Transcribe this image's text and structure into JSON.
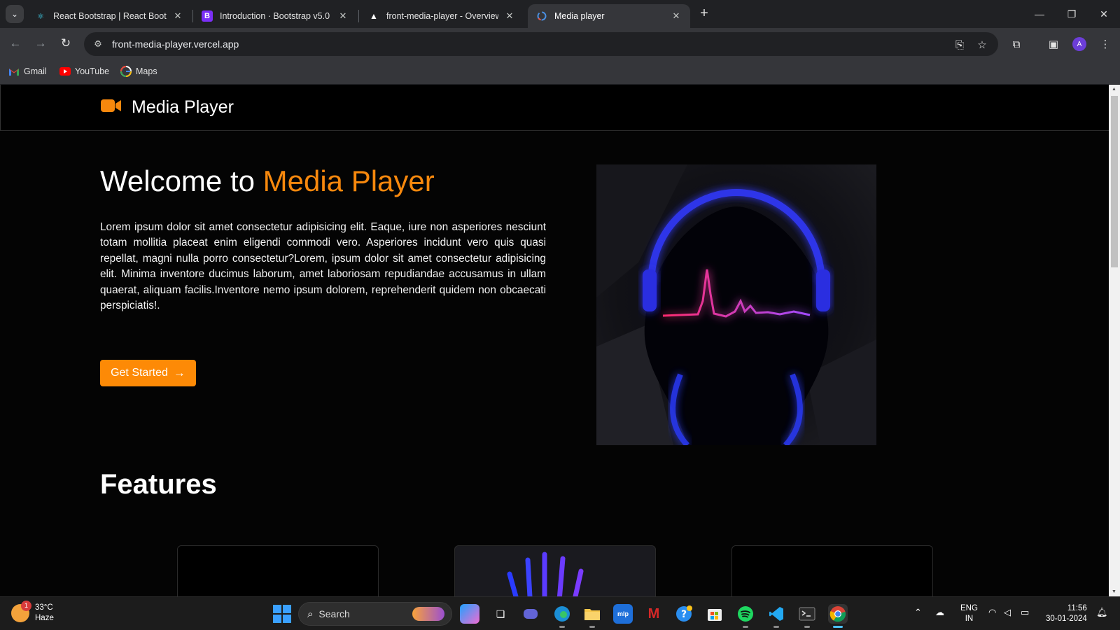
{
  "browser": {
    "tabs": [
      {
        "title": "React Bootstrap | React Bootstrap",
        "favicon": "react-bootstrap-icon"
      },
      {
        "title": "Introduction · Bootstrap v5.0",
        "favicon": "bootstrap-icon"
      },
      {
        "title": "front-media-player - Overview",
        "favicon": "vercel-icon"
      },
      {
        "title": "Media player",
        "favicon": "chrome-loading-icon",
        "active": true
      }
    ],
    "url": "front-media-player.vercel.app",
    "profile_initial": "A",
    "bookmarks": [
      {
        "label": "Gmail",
        "icon": "gmail-icon"
      },
      {
        "label": "YouTube",
        "icon": "youtube-icon"
      },
      {
        "label": "Maps",
        "icon": "google-icon"
      }
    ]
  },
  "page": {
    "brand": "Media Player",
    "hero_title_prefix": "Welcome to ",
    "hero_title_accent": "Media Player",
    "hero_text": "Lorem ipsum dolor sit amet consectetur adipisicing elit. Eaque, iure non asperiores nesciunt totam mollitia placeat enim eligendi commodi vero. Asperiores incidunt vero quis quasi repellat, magni nulla porro consectetur?Lorem, ipsum dolor sit amet consectetur adipisicing elit. Minima inventore ducimus laborum, amet laboriosam repudiandae accusamus in ullam quaerat, aliquam facilis.Inventore nemo ipsum dolorem, reprehenderit quidem non obcaecati perspiciatis!.",
    "cta_label": "Get Started",
    "cta_arrow": "→",
    "features_heading": "Features",
    "accent_color": "#f7880d"
  },
  "taskbar": {
    "weather_temp": "33°C",
    "weather_desc": "Haze",
    "weather_badge": "1",
    "search_label": "Search",
    "lang_1": "ENG",
    "lang_2": "IN",
    "time": "11:56",
    "date": "30-01-2024"
  }
}
